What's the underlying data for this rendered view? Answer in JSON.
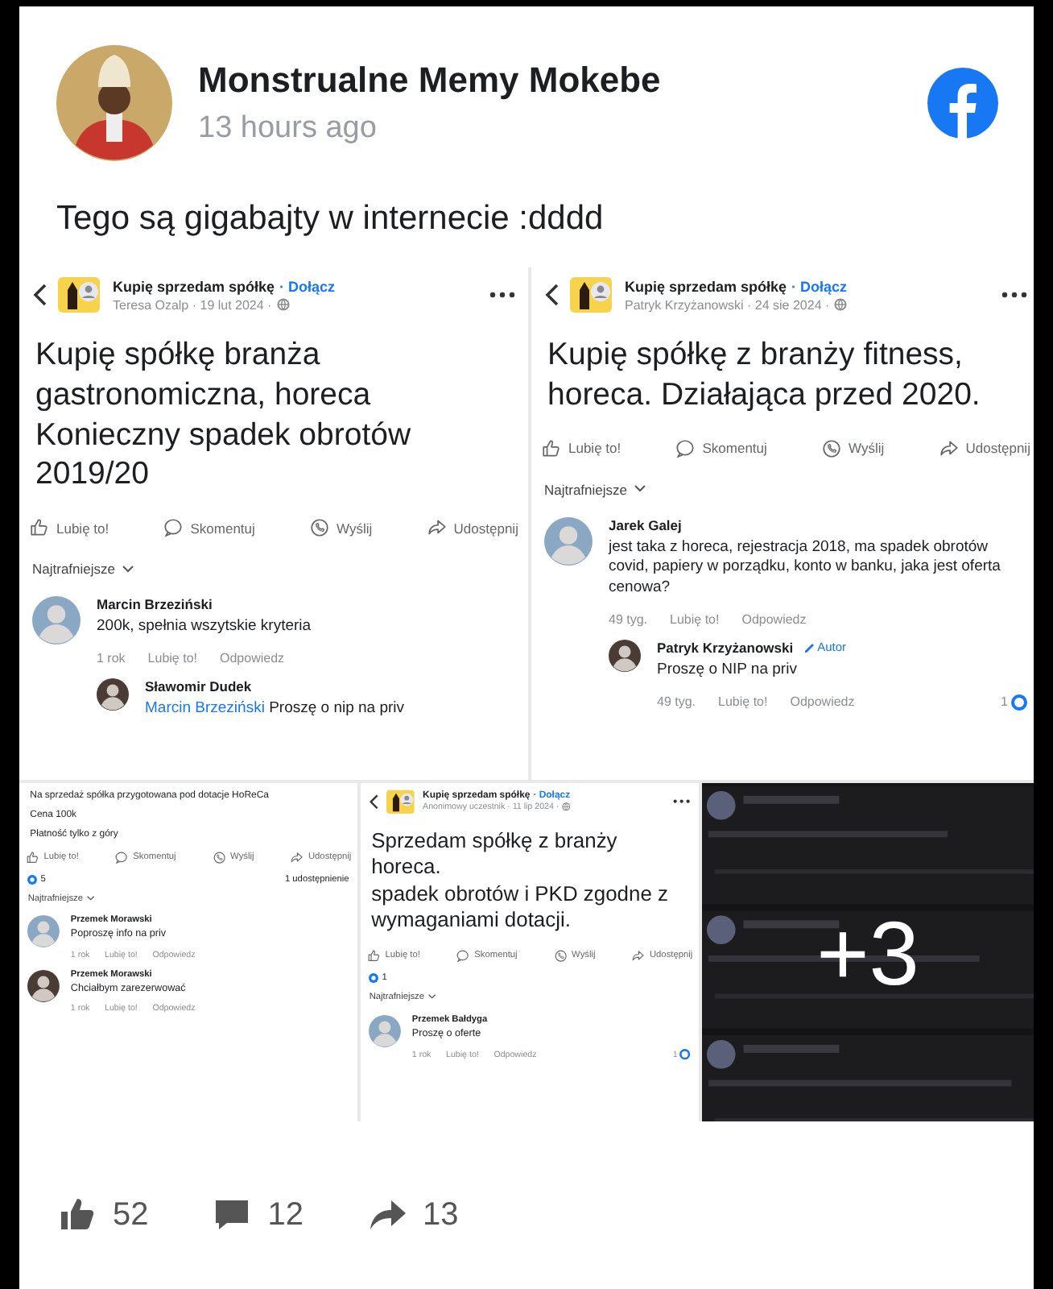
{
  "post": {
    "author": "Monstrualne Memy Mokebe",
    "time": "13 hours ago",
    "text": "Tego są gigabajty w internecie :dddd"
  },
  "images": [
    {
      "kind": "post",
      "header": {
        "group": "Kupię sprzedam spółkę",
        "join": "· Dołącz",
        "byline": "Teresa Ozalp · 19 lut 2024 ·"
      },
      "title_lines": [
        "Kupię spółkę branża gastronomiczna, horeca",
        "Konieczny spadek obrotów 2019/20"
      ],
      "actions": [
        "Lubię to!",
        "Skomentuj",
        "Wyślij",
        "Udostępnij"
      ],
      "sort": "Najtrafniejsze",
      "comments": [
        {
          "name": "Marcin Brzeziński",
          "text": "200k, spełnia wszytskie kryteria",
          "meta": [
            "1 rok",
            "Lubię to!",
            "Odpowiedz"
          ],
          "replies": [
            {
              "name": "Sławomir Dudek",
              "mention": "Marcin Brzeziński",
              "text": "Proszę o nip na priv"
            }
          ]
        }
      ]
    },
    {
      "kind": "post",
      "header": {
        "group": "Kupię sprzedam spółkę",
        "join": "· Dołącz",
        "byline": "Patryk Krzyżanowski · 24 sie 2024 ·"
      },
      "title_lines": [
        "Kupię spółkę z branży fitness, horeca. Działająca przed 2020."
      ],
      "actions": [
        "Lubię to!",
        "Skomentuj",
        "Wyślij",
        "Udostępnij"
      ],
      "sort": "Najtrafniejsze",
      "comments": [
        {
          "name": "Jarek Galej",
          "text": "jest taka z horeca, rejestracja 2018, ma spadek obrotów covid, papiery w porządku, konto w banku, jaka jest oferta cenowa?",
          "meta": [
            "49 tyg.",
            "Lubię to!",
            "Odpowiedz"
          ],
          "replies": [
            {
              "name": "Patryk Krzyżanowski",
              "badge": "Autor",
              "text": "Proszę o NIP na priv",
              "meta": [
                "49 tyg.",
                "Lubię to!",
                "Odpowiedz"
              ],
              "reactions": "1"
            }
          ]
        }
      ]
    },
    {
      "kind": "post",
      "text_lines": [
        "Na sprzedaż spółka przygotowana pod dotacje HoReCa",
        "Cena 100k",
        "Płatność tylko z góry"
      ],
      "actions": [
        "Lubię to!",
        "Skomentuj",
        "Wyślij",
        "Udostępnij"
      ],
      "reactions": {
        "count": "5",
        "shares": "1 udostępnienie"
      },
      "sort": "Najtrafniejsze",
      "comments": [
        {
          "name": "Przemek Morawski",
          "text": "Poproszę info na priv",
          "meta": [
            "1 rok",
            "Lubię to!",
            "Odpowiedz"
          ]
        },
        {
          "name": "Przemek Morawski",
          "text": "Chciałbym zarezerwować",
          "meta": [
            "1 rok",
            "Lubię to!",
            "Odpowiedz"
          ]
        }
      ]
    },
    {
      "kind": "post",
      "header": {
        "group": "Kupię sprzedam spółkę",
        "join": "· Dołącz",
        "byline": "Anonimowy uczestnik · 11 lip 2024 ·"
      },
      "title_lines": [
        "Sprzedam spółkę z branży horeca.",
        "spadek obrotów i PKD zgodne z wymaganiami dotacji."
      ],
      "actions": [
        "Lubię to!",
        "Skomentuj",
        "Wyślij",
        "Udostępnij"
      ],
      "reactions": {
        "count": "1"
      },
      "sort": "Najtrafniejsze",
      "comments": [
        {
          "name": "Przemek Bałdyga",
          "text": "Proszę o oferte",
          "meta": [
            "1 rok",
            "Lubię to!",
            "Odpowiedz"
          ],
          "reactions": "1"
        }
      ]
    },
    {
      "kind": "more",
      "overlay": "+3"
    }
  ],
  "footer": {
    "likes": "52",
    "comments": "12",
    "shares": "13"
  }
}
